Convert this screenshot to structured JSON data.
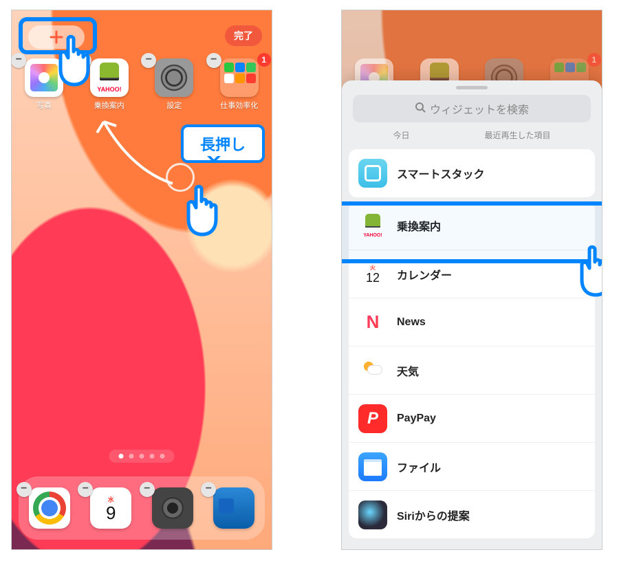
{
  "left": {
    "done_label": "完了",
    "apps": [
      {
        "name": "photos",
        "label": "写真"
      },
      {
        "name": "norikae",
        "label": "乗換案内"
      },
      {
        "name": "settings",
        "label": "設定"
      },
      {
        "name": "folder",
        "label": "仕事効率化",
        "badge": "1"
      }
    ],
    "callout": "長押し",
    "calendar": {
      "dow": "水",
      "day": "9"
    },
    "plus_glyph": "+"
  },
  "right": {
    "search_placeholder": "ウィジェットを検索",
    "segments": [
      "今日",
      "最近再生した項目"
    ],
    "calendar_icon": {
      "dow": "火",
      "day": "12"
    },
    "rows": [
      {
        "key": "stack",
        "label": "スマートスタック"
      },
      {
        "key": "norikae2",
        "label": "乗換案内"
      },
      {
        "key": "cal2",
        "label": "カレンダー"
      },
      {
        "key": "news",
        "label": "News"
      },
      {
        "key": "weather",
        "label": "天気"
      },
      {
        "key": "paypay",
        "label": "PayPay"
      },
      {
        "key": "files",
        "label": "ファイル"
      },
      {
        "key": "siri",
        "label": "Siriからの提案"
      }
    ]
  }
}
